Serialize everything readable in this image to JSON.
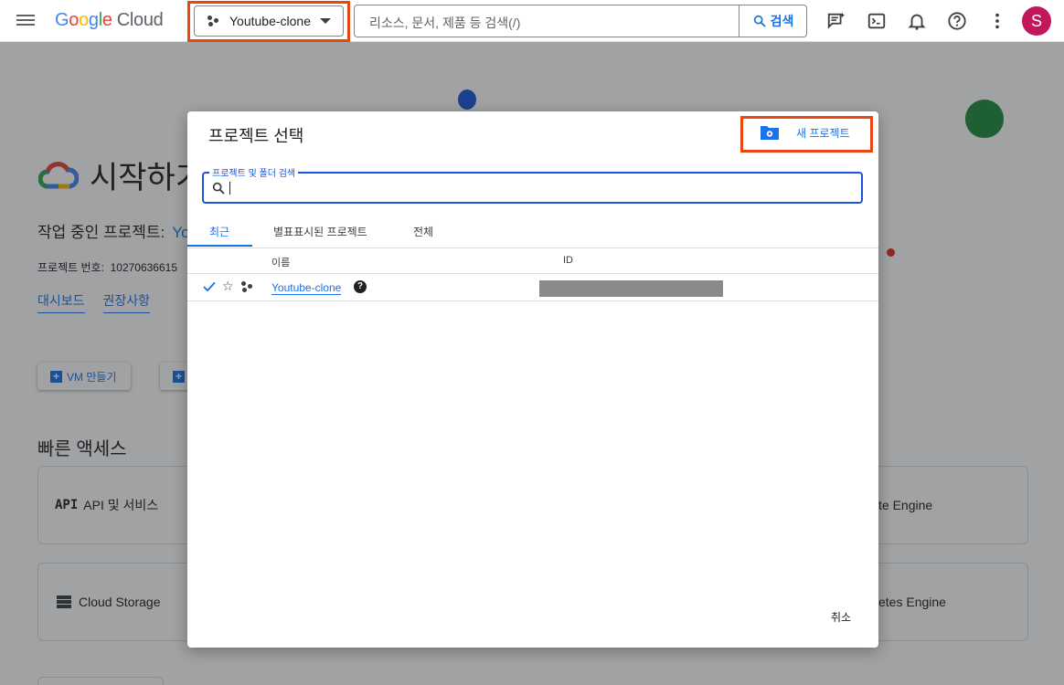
{
  "topbar": {
    "logo": {
      "google": "Google",
      "cloud": "Cloud"
    },
    "project_button": "Youtube-clone",
    "search": {
      "placeholder": "리소스, 문서, 제품 등 검색(/)",
      "button": "검색"
    },
    "icons": [
      "assistant-icon",
      "terminal-icon",
      "bell-icon",
      "help-icon",
      "more-vert-icon"
    ],
    "avatar_letter": "S"
  },
  "background": {
    "title": "시작하기",
    "working_project_label": "작업 중인 프로젝트:",
    "working_project_value": "Yo",
    "project_number_label": "프로젝트 번호:",
    "project_number_value": "10270636615",
    "links": [
      "대시보드",
      "권장사항"
    ],
    "create_vm": "VM 만들기",
    "quick_access": "빠른 액세스",
    "cards": {
      "api": {
        "icon_text": "API",
        "label": "API 및 서비스"
      },
      "storage": "Cloud Storage",
      "compute": "te Engine",
      "kubernetes": "etes Engine"
    }
  },
  "dialog": {
    "title": "프로젝트 선택",
    "new_project": "새 프로젝트",
    "search_label": "프로젝트 및 폴더 검색",
    "tabs": [
      "최근",
      "별표표시된 프로젝트",
      "전체"
    ],
    "active_tab": 0,
    "columns": {
      "name": "이름",
      "id": "ID"
    },
    "rows": [
      {
        "name": "Youtube-clone",
        "selected": true
      }
    ],
    "cancel": "취소"
  },
  "colors": {
    "accent": "#1a73e8",
    "highlight": "#e8470f"
  }
}
